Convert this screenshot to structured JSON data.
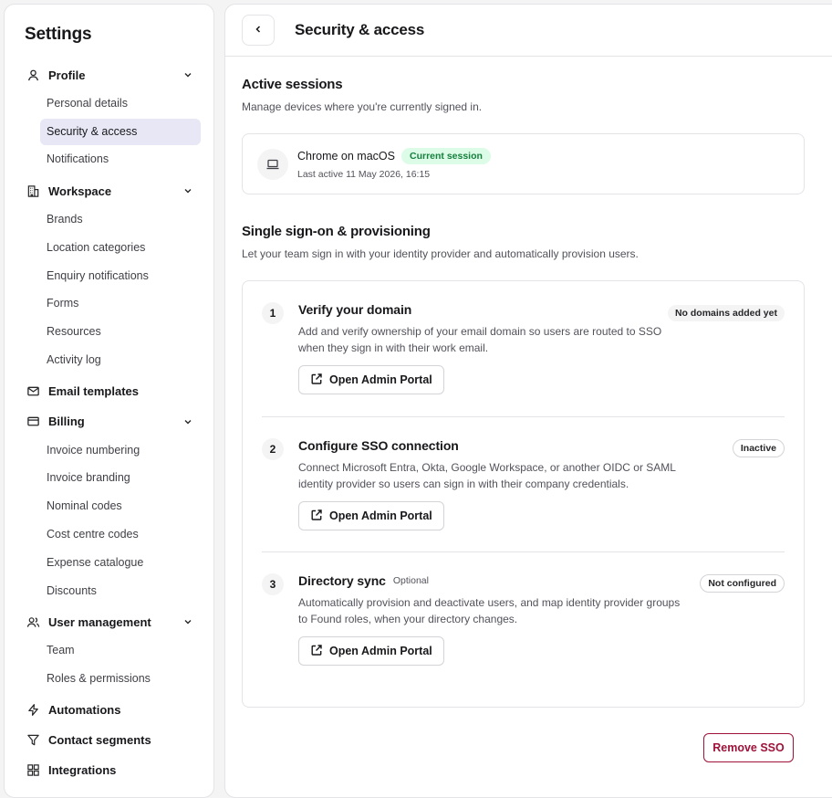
{
  "sidebar": {
    "title": "Settings",
    "groups": {
      "profile": {
        "label": "Profile",
        "items": [
          "Personal details",
          "Security & access",
          "Notifications"
        ]
      },
      "workspace": {
        "label": "Workspace",
        "items": [
          "Brands",
          "Location categories",
          "Enquiry notifications",
          "Forms",
          "Resources",
          "Activity log"
        ]
      },
      "email_templates": {
        "label": "Email templates"
      },
      "billing": {
        "label": "Billing",
        "items": [
          "Invoice numbering",
          "Invoice branding",
          "Nominal codes",
          "Cost centre codes",
          "Expense catalogue",
          "Discounts"
        ]
      },
      "user_management": {
        "label": "User management",
        "items": [
          "Team",
          "Roles & permissions"
        ]
      },
      "automations": {
        "label": "Automations"
      },
      "contact_segments": {
        "label": "Contact segments"
      },
      "integrations": {
        "label": "Integrations"
      }
    },
    "active_item": "Security & access"
  },
  "header": {
    "title": "Security & access",
    "back_icon": "chevron-left-icon"
  },
  "sessions": {
    "title": "Active sessions",
    "subtitle": "Manage devices where you're currently signed in.",
    "items": [
      {
        "device": "Chrome on macOS",
        "badge": "Current session",
        "last_active": "Last active 11 May 2026, 16:15",
        "icon": "laptop-icon"
      }
    ]
  },
  "sso": {
    "title": "Single sign-on & provisioning",
    "subtitle": "Let your team sign in with your identity provider and automatically provision users.",
    "steps": [
      {
        "number": "1",
        "title": "Verify your domain",
        "optional": "",
        "status": "No domains added yet",
        "description": "Add and verify ownership of your email domain so users are routed to SSO when they sign in with their work email.",
        "button": "Open Admin Portal"
      },
      {
        "number": "2",
        "title": "Configure SSO connection",
        "optional": "",
        "status": "Inactive",
        "description": "Connect Microsoft Entra, Okta, Google Workspace, or another OIDC or SAML identity provider so users can sign in with their company credentials.",
        "button": "Open Admin Portal"
      },
      {
        "number": "3",
        "title": "Directory sync",
        "optional": "Optional",
        "status": "Not configured",
        "description": "Automatically provision and deactivate users, and map identity provider groups to Found roles, when your directory changes.",
        "button": "Open Admin Portal"
      }
    ],
    "remove_button": "Remove SSO"
  },
  "colors": {
    "active_nav_bg": "#e7e7f6",
    "current_session_badge": "#15803d",
    "danger": "#9f1239"
  }
}
